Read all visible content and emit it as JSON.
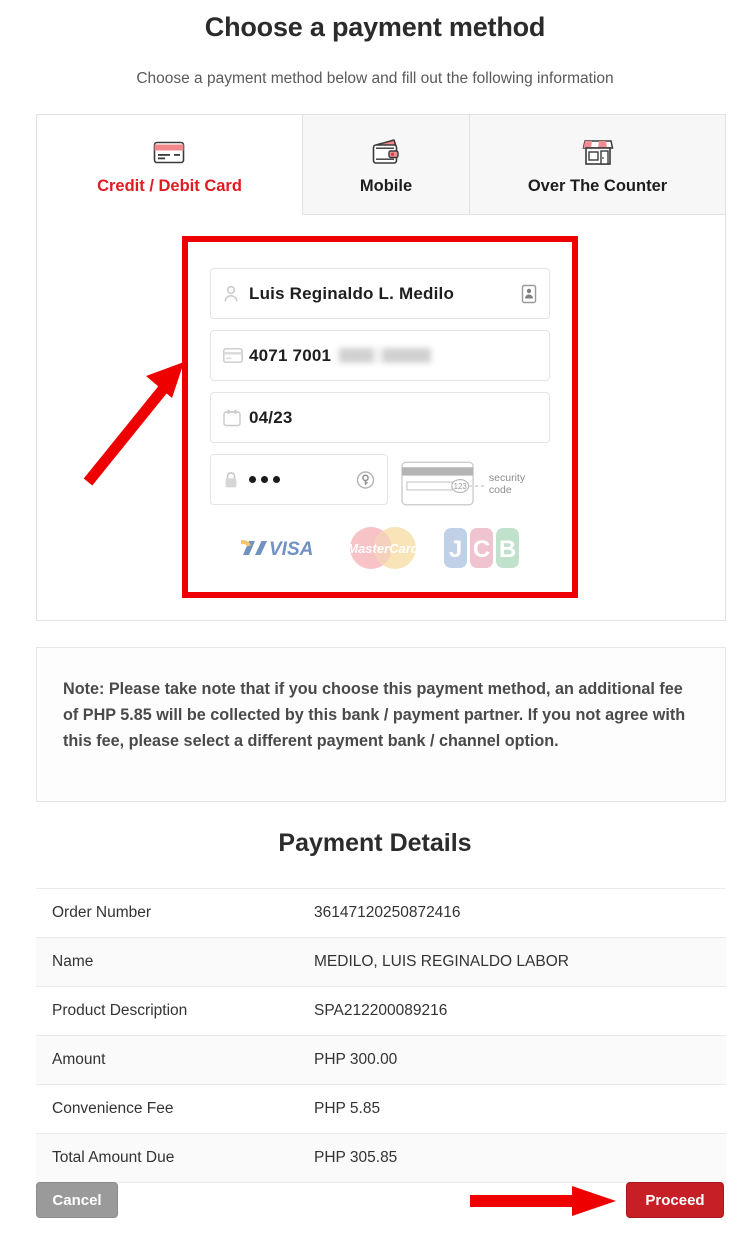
{
  "header": {
    "title": "Choose a payment method",
    "subtitle": "Choose a payment method below and fill out the following information"
  },
  "tabs": [
    {
      "label": "Credit / Debit Card",
      "icon": "credit-card-icon",
      "active": true
    },
    {
      "label": "Mobile",
      "icon": "wallet-icon",
      "active": false
    },
    {
      "label": "Over The Counter",
      "icon": "storefront-icon",
      "active": false
    }
  ],
  "card_form": {
    "cardholder_name": "Luis Reginaldo L. Medilo",
    "card_number_visible": "4071 7001",
    "card_number_masked": true,
    "expiry": "04/23",
    "cvv_masked": "●●●",
    "security_code_label": "security code",
    "security_code_sample": "123",
    "brands": [
      "VISA",
      "MasterCard",
      "JCB"
    ],
    "icons": {
      "name_left": "person-icon",
      "name_right": "contact-card-icon",
      "number_left": "credit-card-icon",
      "expiry_left": "calendar-icon",
      "cvv_left": "lock-icon",
      "cvv_right": "key-circle-icon"
    }
  },
  "note": {
    "text": "Note: Please take note that if you choose this payment method, an additional fee of PHP 5.85 will be collected by this bank / payment partner. If you not agree with this fee, please select a different payment bank / channel option."
  },
  "payment_details": {
    "title": "Payment Details",
    "rows": [
      {
        "label": "Order Number",
        "value": "36147120250872416"
      },
      {
        "label": "Name",
        "value": "MEDILO, LUIS REGINALDO LABOR"
      },
      {
        "label": "Product Description",
        "value": "SPA212200089216"
      },
      {
        "label": "Amount",
        "value": "PHP 300.00"
      },
      {
        "label": "Convenience Fee",
        "value": "PHP 5.85"
      },
      {
        "label": "Total Amount Due",
        "value": "PHP 305.85"
      }
    ]
  },
  "footer": {
    "cancel_label": "Cancel",
    "proceed_label": "Proceed"
  },
  "annotations": {
    "highlight_color": "#ee0000",
    "arrow_color": "#ee0000"
  },
  "colors": {
    "accent_red": "#e01c22",
    "proceed_red": "#c62026",
    "cancel_gray": "#9a9a9a"
  }
}
